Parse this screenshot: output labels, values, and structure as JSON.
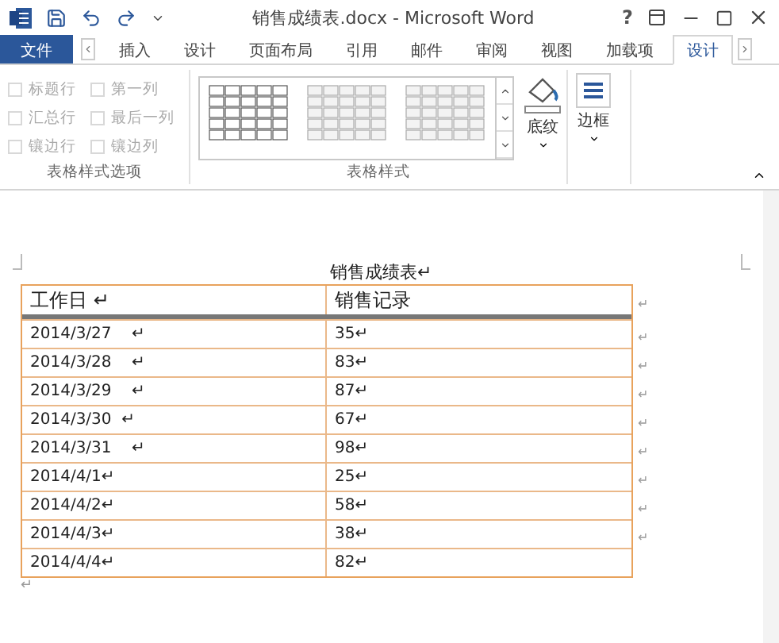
{
  "window": {
    "title": "销售成绩表.docx - Microsoft Word",
    "help": "?"
  },
  "tabs": [
    {
      "label": "文件",
      "kind": "file",
      "selected": false
    },
    {
      "label": "插入",
      "kind": "tab",
      "selected": false
    },
    {
      "label": "设计",
      "kind": "tab",
      "selected": false
    },
    {
      "label": "页面布局",
      "kind": "tab",
      "selected": false
    },
    {
      "label": "引用",
      "kind": "tab",
      "selected": false
    },
    {
      "label": "邮件",
      "kind": "tab",
      "selected": false
    },
    {
      "label": "审阅",
      "kind": "tab",
      "selected": false
    },
    {
      "label": "视图",
      "kind": "tab",
      "selected": false
    },
    {
      "label": "加载项",
      "kind": "tab",
      "selected": false
    },
    {
      "label": "设计",
      "kind": "tab",
      "selected": true
    }
  ],
  "ribbon": {
    "style_options": {
      "label": "表格样式选项",
      "options": [
        {
          "label": "标题行",
          "checked": false,
          "disabled": true
        },
        {
          "label": "第一列",
          "checked": false,
          "disabled": true
        },
        {
          "label": "汇总行",
          "checked": false,
          "disabled": true
        },
        {
          "label": "最后一列",
          "checked": false,
          "disabled": true
        },
        {
          "label": "镶边行",
          "checked": false,
          "disabled": true
        },
        {
          "label": "镶边列",
          "checked": false,
          "disabled": true
        }
      ]
    },
    "table_styles": {
      "label": "表格样式",
      "shading": "底纹"
    },
    "borders": {
      "label": "边框"
    }
  },
  "document": {
    "title": "销售成绩表↵",
    "after_table": "↵",
    "table": {
      "columns": [
        {
          "text": "工作日 ↵"
        },
        {
          "text": "销售记录"
        }
      ],
      "header_end": "↵",
      "rows": [
        {
          "cells": [
            "2014/3/27    ↵",
            "35↵"
          ],
          "end": "↵"
        },
        {
          "cells": [
            "2014/3/28    ↵",
            "83↵"
          ],
          "end": "↵"
        },
        {
          "cells": [
            "2014/3/29    ↵",
            "87↵"
          ],
          "end": "↵"
        },
        {
          "cells": [
            "2014/3/30  ↵",
            "67↵"
          ],
          "end": "↵"
        },
        {
          "cells": [
            "2014/3/31    ↵",
            "98↵"
          ],
          "end": "↵"
        },
        {
          "cells": [
            "2014/4/1↵",
            "25↵"
          ],
          "end": "↵"
        },
        {
          "cells": [
            "2014/4/2↵",
            "58↵"
          ],
          "end": "↵"
        },
        {
          "cells": [
            "2014/4/3↵",
            "38↵"
          ],
          "end": "↵"
        },
        {
          "cells": [
            "2014/4/4↵",
            "82↵"
          ],
          "end": ""
        }
      ]
    }
  }
}
